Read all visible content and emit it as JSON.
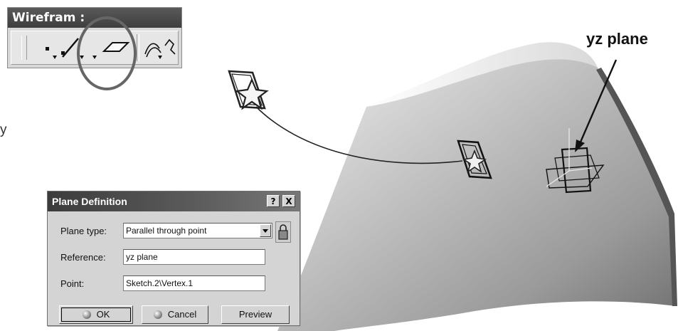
{
  "toolbar": {
    "title": "Wirefram :",
    "buttons": [
      "point-icon",
      "line-icon",
      "plane-icon",
      "curve-icon"
    ]
  },
  "callout": {
    "label": "yz plane"
  },
  "stray_text": "y",
  "dialog": {
    "title": "Plane Definition",
    "help_label": "?",
    "close_label": "X",
    "plane_type_label": "Plane type:",
    "plane_type_value": "Parallel through point",
    "reference_label": "Reference:",
    "reference_value": "yz plane",
    "point_label": "Point:",
    "point_value": "Sketch.2\\Vertex.1",
    "ok_label": "OK",
    "cancel_label": "Cancel",
    "preview_label": "Preview"
  },
  "colors": {
    "surface_light": "#eeeeee",
    "surface_dark": "#7d7d7d",
    "title_bar": "#3c3c3c",
    "highlight_circle": "#666666"
  }
}
